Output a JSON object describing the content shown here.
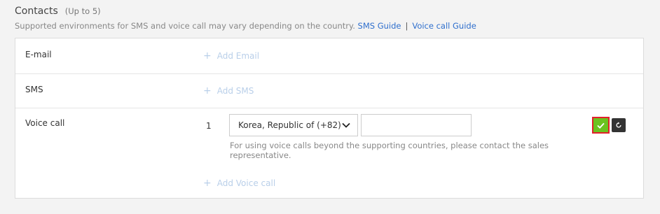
{
  "section": {
    "title": "Contacts",
    "limit": "(Up to 5)",
    "description": "Supported environments for SMS and voice call may vary depending on the country.",
    "sms_guide": "SMS Guide",
    "separator": "|",
    "voice_guide": "Voice call Guide"
  },
  "rows": {
    "email": {
      "label": "E-mail",
      "add": "Add Email"
    },
    "sms": {
      "label": "SMS",
      "add": "Add SMS"
    },
    "voice": {
      "label": "Voice call",
      "index": "1",
      "country": "Korea, Republic of (+82)",
      "phone_value": "",
      "hint": "For using voice calls beyond the supporting countries, please contact the sales representative.",
      "add": "Add Voice call"
    }
  },
  "icons": {
    "plus": "plus-icon",
    "chevron": "chevron-down-icon",
    "confirm": "check-icon",
    "reset": "refresh-icon"
  },
  "colors": {
    "link": "#2f6fcd",
    "add_link": "#b9cfe9",
    "confirm_bg": "#6cc21f",
    "confirm_border": "#e2202b",
    "reset_bg": "#333333"
  }
}
